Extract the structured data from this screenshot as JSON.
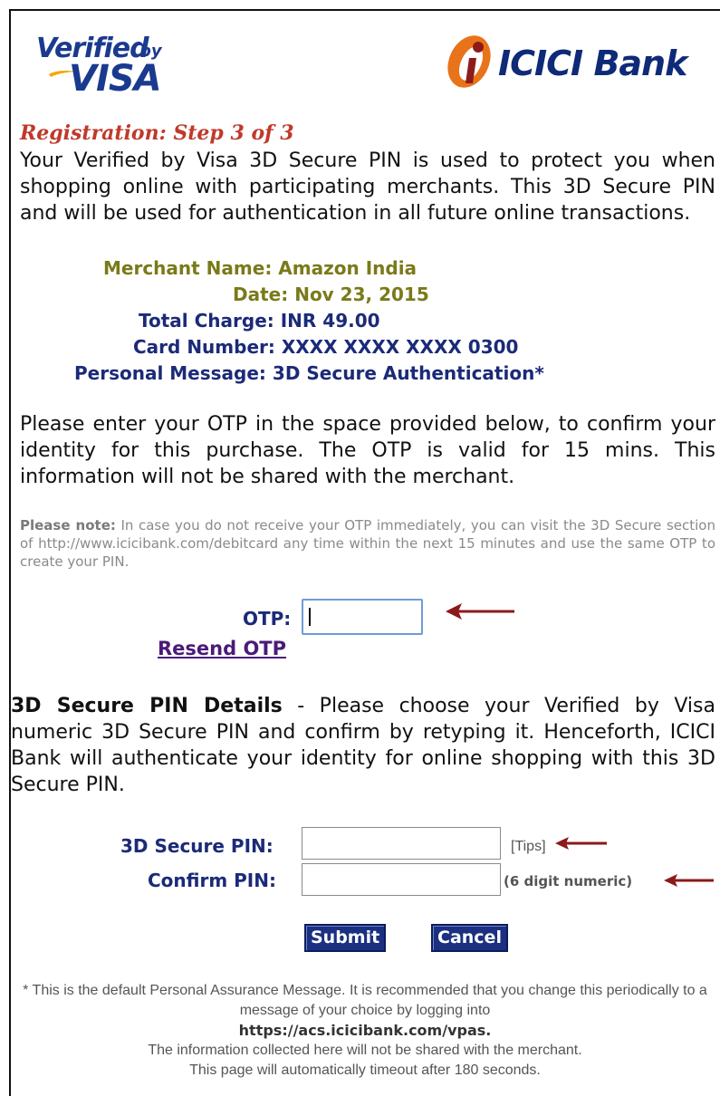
{
  "logos": {
    "visa_line1": "Verified",
    "visa_by": "by",
    "visa_line2": "VISA",
    "icici_name": "ICICI",
    "icici_bank": "Bank"
  },
  "step_title": "Registration: Step 3 of 3",
  "intro": "Your Verified by Visa 3D Secure PIN is used to protect you when shopping online with participating merchants. This 3D Secure PIN and will be used for authentication in all future online transactions.",
  "details": {
    "merchant_label": "Merchant Name:",
    "merchant_value": "Amazon India",
    "date_label": "Date:",
    "date_value": "Nov 23, 2015",
    "charge_label": "Total Charge:",
    "charge_value": "INR 49.00",
    "card_label": "Card Number:",
    "card_value": "XXXX XXXX XXXX 0300",
    "message_label": "Personal Message:",
    "message_value": "3D Secure Authentication*"
  },
  "otp_instructions": "Please enter your OTP in the space provided below, to confirm your identity for this purchase. The OTP is valid for 15 mins. This information will not be shared with the merchant.",
  "note": {
    "label": "Please note:",
    "text": " In case you do not receive your OTP immediately, you can visit the 3D Secure section of http://www.icicibank.com/debitcard any time within the next 15 minutes and use the same OTP to create your PIN."
  },
  "otp": {
    "label": "OTP:",
    "value": "",
    "resend_label": "Resend OTP"
  },
  "pin_section": {
    "heading": "3D Secure PIN Details",
    "text": " - Please choose your Verified by Visa numeric 3D Secure PIN and confirm by retyping it. Henceforth, ICICI Bank will authenticate your identity for online shopping with this 3D Secure PIN."
  },
  "pin_form": {
    "pin_label": "3D Secure PIN:",
    "confirm_label": "Confirm PIN:",
    "pin_value": "",
    "confirm_value": "",
    "tips_label": "[Tips]",
    "digits_hint": "(6 digit numeric)"
  },
  "buttons": {
    "submit": "Submit",
    "cancel": "Cancel"
  },
  "footer": {
    "line1": "* This is the default Personal Assurance Message. It is recommended that you change this periodically to a message of your choice by logging into",
    "url": "https://acs.icicibank.com/vpas.",
    "line2": "The information collected here will not be shared with the merchant.",
    "line3": "This page will automatically timeout after 180 seconds."
  },
  "colors": {
    "step_red": "#c0392b",
    "navy": "#1b2a78",
    "olive": "#7a7a1a",
    "arrow_red": "#8b1a1a",
    "button_blue": "#1b3080",
    "icici_orange": "#e8731a",
    "icici_maroon": "#8e1b1b"
  },
  "icons": [
    "red-arrow-icon",
    "icici-i-mark-icon",
    "visa-swoosh-icon"
  ]
}
